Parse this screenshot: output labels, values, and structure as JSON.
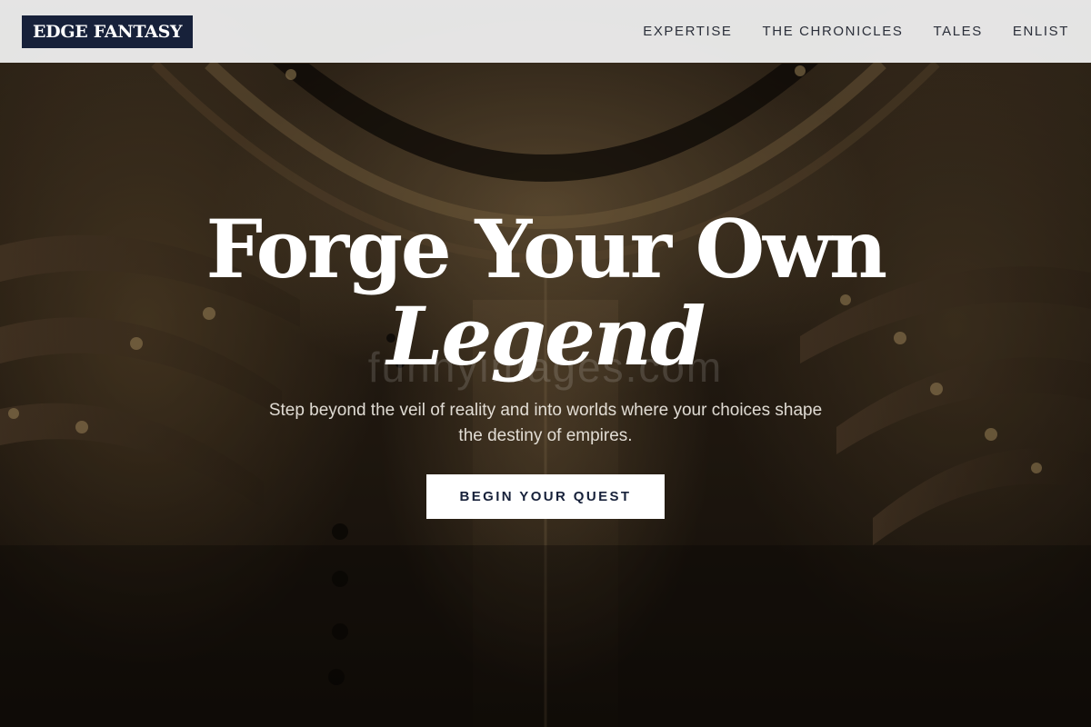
{
  "header": {
    "logo": "EDGE FANTASY",
    "nav": [
      {
        "label": "EXPERTISE"
      },
      {
        "label": "THE CHRONICLES"
      },
      {
        "label": "TALES"
      },
      {
        "label": "ENLIST"
      }
    ]
  },
  "hero": {
    "headline_line1": "Forge Your Own",
    "headline_line2": "Legend",
    "subtitle": "Step beyond the veil of reality and into worlds where your choices shape the destiny of empires.",
    "cta_label": "BEGIN YOUR QUEST",
    "watermark": "funnyimages.com",
    "background_image": "ornate-armor-breastplate"
  },
  "colors": {
    "header_bg": "#ececec",
    "logo_bg": "#17213a",
    "nav_text": "#2b2f3a",
    "cta_bg": "#ffffff",
    "cta_text": "#17213a",
    "headline": "#ffffff"
  }
}
